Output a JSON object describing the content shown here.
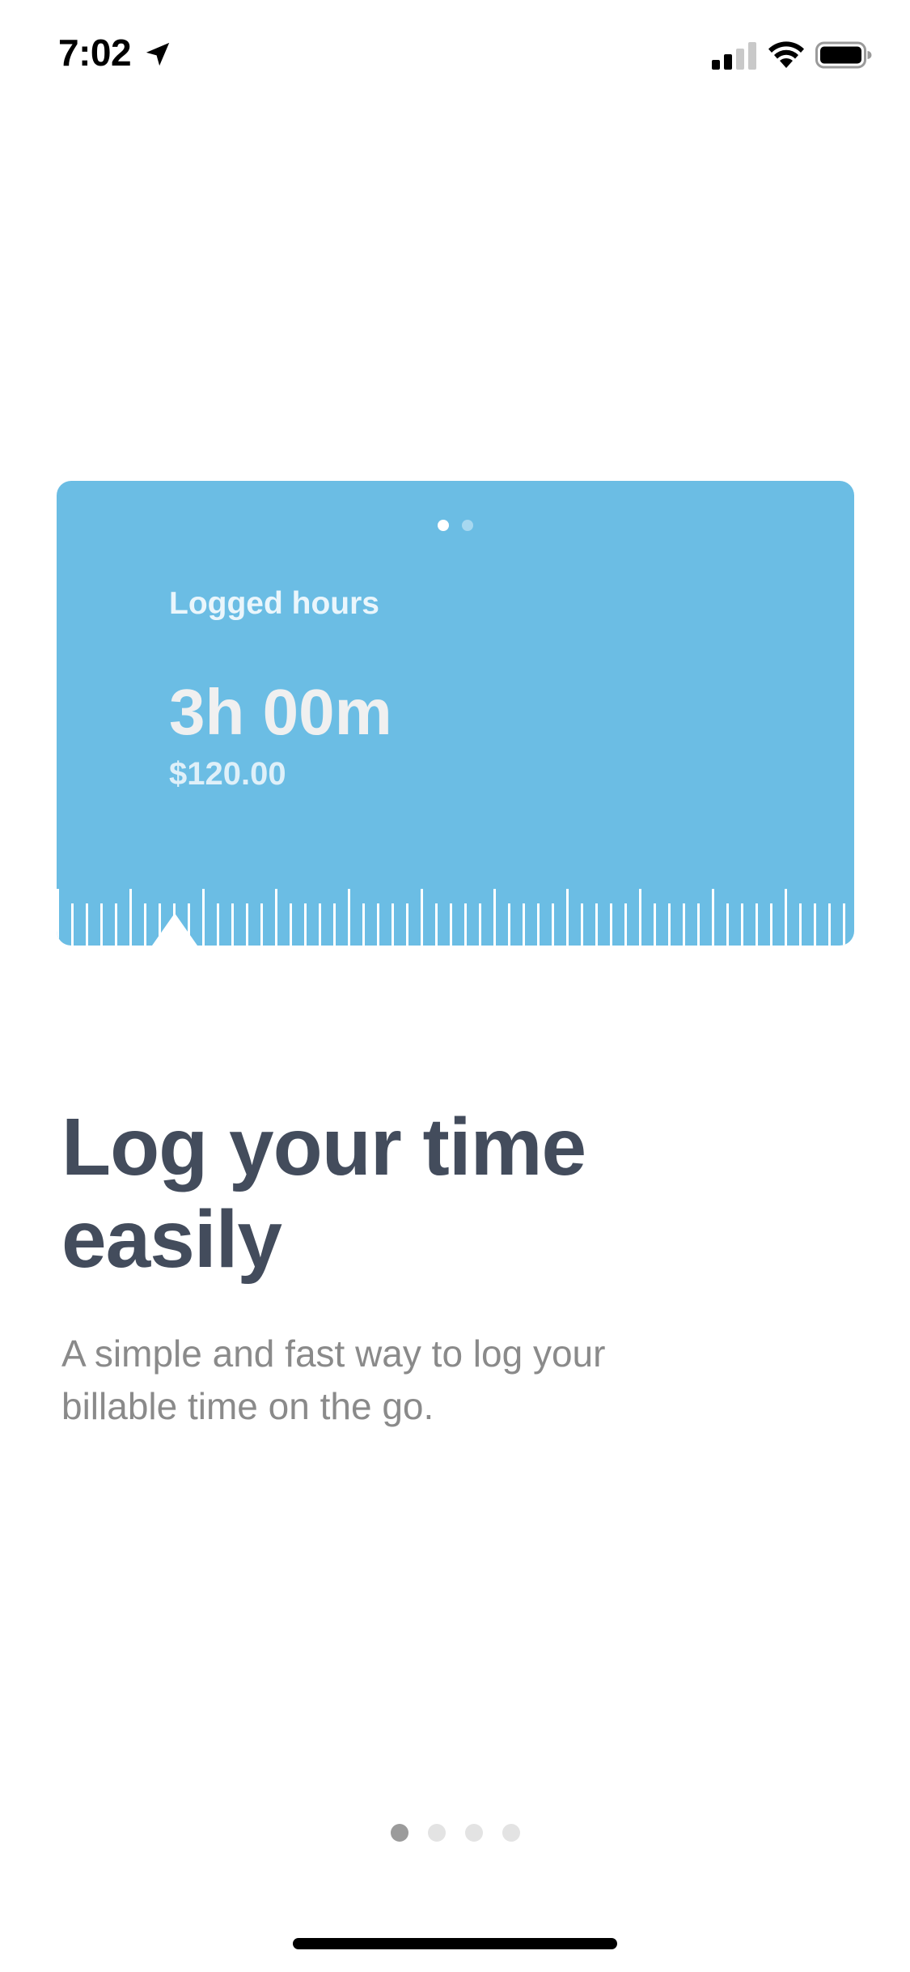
{
  "status_bar": {
    "time": "7:02",
    "location_icon": "location-arrow-icon",
    "signal_icon": "cellular-signal-icon",
    "wifi_icon": "wifi-icon",
    "battery_icon": "battery-icon"
  },
  "card": {
    "background_color": "#6bbde4",
    "page_indicator": {
      "count": 2,
      "active_index": 0
    },
    "label": "Logged hours",
    "hours": "3h 00m",
    "amount": "$120.00",
    "ruler_icon": "time-ruler-scale",
    "pointer_icon": "ruler-pointer-triangle"
  },
  "onboarding": {
    "title": "Log your time easily",
    "subtitle": "A simple and fast way to log your billable time on the go."
  },
  "pager": {
    "count": 4,
    "active_index": 0
  },
  "colors": {
    "title": "#434c5c",
    "subtitle": "#8a8a8a",
    "pager_active": "#9b9b9b",
    "pager_inactive": "#e3e3e3"
  }
}
